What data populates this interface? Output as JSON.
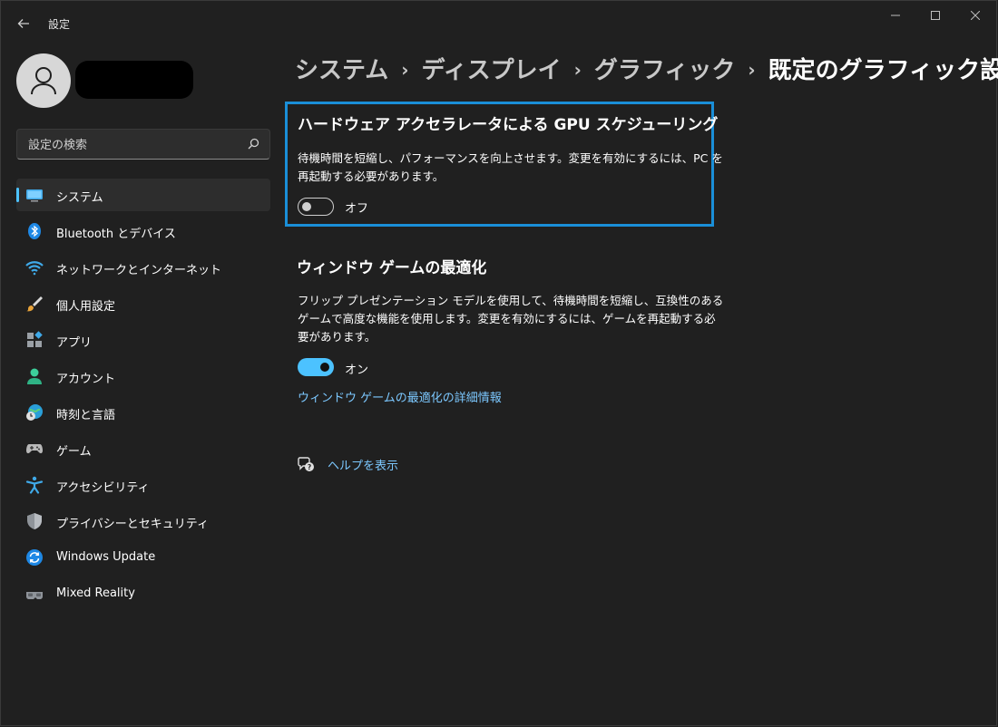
{
  "window": {
    "title": "設定"
  },
  "search": {
    "placeholder": "設定の検索"
  },
  "nav": {
    "items": [
      {
        "label": "システム",
        "icon": "monitor-icon",
        "active": true
      },
      {
        "label": "Bluetooth とデバイス",
        "icon": "bluetooth-icon"
      },
      {
        "label": "ネットワークとインターネット",
        "icon": "wifi-icon"
      },
      {
        "label": "個人用設定",
        "icon": "brush-icon"
      },
      {
        "label": "アプリ",
        "icon": "apps-icon"
      },
      {
        "label": "アカウント",
        "icon": "person-icon"
      },
      {
        "label": "時刻と言語",
        "icon": "globe-clock-icon"
      },
      {
        "label": "ゲーム",
        "icon": "gamepad-icon"
      },
      {
        "label": "アクセシビリティ",
        "icon": "accessibility-icon"
      },
      {
        "label": "プライバシーとセキュリティ",
        "icon": "shield-icon"
      },
      {
        "label": "Windows Update",
        "icon": "update-icon"
      },
      {
        "label": "Mixed Reality",
        "icon": "headset-icon"
      }
    ]
  },
  "breadcrumb": [
    "システム",
    "ディスプレイ",
    "グラフィック",
    "既定のグラフィック設定"
  ],
  "gpu_scheduling": {
    "title": "ハードウェア アクセラレータによる GPU スケジューリング",
    "desc_line1": "待機時間を短縮し、パフォーマンスを向上させます。変更を有効にするには、PC を",
    "desc_line2": "再起動する必要があります。",
    "state_label": "オフ"
  },
  "windowed_game": {
    "title": "ウィンドウ ゲームの最適化",
    "desc_line1": "フリップ プレゼンテーション モデルを使用して、待機時間を短縮し、互換性のある",
    "desc_line2": "ゲームで高度な機能を使用します。変更を有効にするには、ゲームを再起動する必",
    "desc_line3": "要があります。",
    "state_label": "オン",
    "link": "ウィンドウ ゲームの最適化の詳細情報"
  },
  "help": {
    "label": "ヘルプを表示"
  },
  "colors": {
    "accent": "#4cc2ff",
    "highlight": "#1a8fd8",
    "link": "#7cc8ff"
  }
}
